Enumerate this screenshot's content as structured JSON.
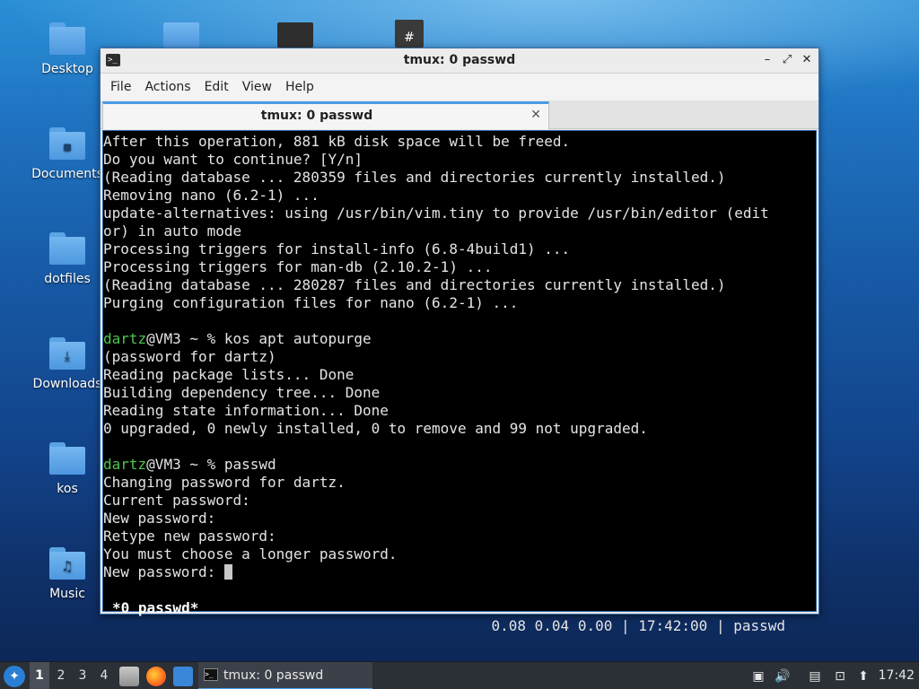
{
  "desktop": {
    "icons": [
      {
        "label": "Desktop",
        "emblem": ""
      },
      {
        "label": "Documents",
        "emblem": "▪"
      },
      {
        "label": "dotfiles",
        "emblem": ""
      },
      {
        "label": "Downloads",
        "emblem": "⤓"
      },
      {
        "label": "kos",
        "emblem": ""
      },
      {
        "label": "Music",
        "emblem": "♫"
      }
    ]
  },
  "window": {
    "title": "tmux: 0 passwd",
    "menu": [
      "File",
      "Actions",
      "Edit",
      "View",
      "Help"
    ],
    "tab_label": "tmux: 0 passwd"
  },
  "terminal": {
    "lines": [
      "After this operation, 881 kB disk space will be freed.",
      "Do you want to continue? [Y/n]",
      "(Reading database ... 280359 files and directories currently installed.)",
      "Removing nano (6.2-1) ...",
      "update-alternatives: using /usr/bin/vim.tiny to provide /usr/bin/editor (edit",
      "or) in auto mode",
      "Processing triggers for install-info (6.8-4build1) ...",
      "Processing triggers for man-db (2.10.2-1) ...",
      "(Reading database ... 280287 files and directories currently installed.)",
      "Purging configuration files for nano (6.2-1) ...",
      "",
      "",
      "(password for dartz)",
      "Reading package lists... Done",
      "Building dependency tree... Done",
      "Reading state information... Done",
      "0 upgraded, 0 newly installed, 0 to remove and 99 not upgraded.",
      "",
      "",
      "Changing password for dartz.",
      "Current password:",
      "New password:",
      "Retype new password:",
      "You must choose a longer password.",
      "New password: "
    ],
    "prompt1_user": "dartz",
    "prompt1_rest": "@VM3 ~ % kos apt autopurge",
    "prompt2_user": "dartz",
    "prompt2_rest": "@VM3 ~ % passwd",
    "status_left": "*0 passwd*",
    "status_right": "0.08 0.04 0.00 | 17:42:00 | passwd"
  },
  "taskbar": {
    "workspaces": [
      "1",
      "2",
      "3",
      "4"
    ],
    "active_workspace": "1",
    "task_label": "tmux: 0 passwd",
    "clock": "17:42"
  }
}
